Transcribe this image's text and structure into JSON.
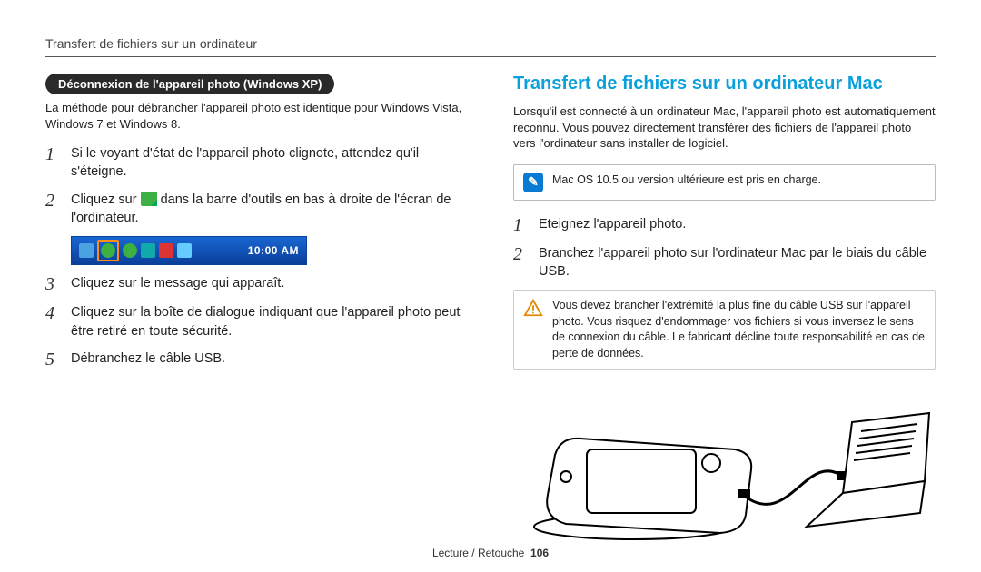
{
  "running_head": "Transfert de fichiers sur un ordinateur",
  "left": {
    "pill": "Déconnexion de l'appareil photo (Windows XP)",
    "intro": "La méthode pour débrancher l'appareil photo est identique pour Windows Vista, Windows 7 et Windows 8.",
    "steps": {
      "s1": "Si le voyant d'état de l'appareil photo clignote, attendez qu'il s'éteigne.",
      "s2_a": "Cliquez sur ",
      "s2_b": " dans la barre d'outils en bas à droite de l'écran de l'ordinateur.",
      "s3": "Cliquez sur le message qui apparaît.",
      "s4": "Cliquez sur la boîte de dialogue indiquant que l'appareil photo peut être retiré en toute sécurité.",
      "s5": "Débranchez le câble USB."
    },
    "tray_time": "10:00 AM"
  },
  "right": {
    "heading": "Transfert de fichiers sur un ordinateur Mac",
    "intro": "Lorsqu'il est connecté à un ordinateur Mac, l'appareil photo est automatiquement reconnu. Vous pouvez directement transférer des fichiers de l'appareil photo vers l'ordinateur sans installer de logiciel.",
    "note": "Mac OS 10.5 ou version ultérieure est pris en charge.",
    "steps": {
      "s1": "Eteignez l'appareil photo.",
      "s2": "Branchez l'appareil photo sur l'ordinateur Mac par le biais du câble USB."
    },
    "warn": "Vous devez brancher l'extrémité la plus fine du câble USB sur l'appareil photo. Vous risquez d'endommager vos fichiers si vous inversez le sens de connexion du câble. Le fabricant décline toute responsabilité en cas de perte de données."
  },
  "footer": {
    "section": "Lecture / Retouche",
    "page": "106"
  },
  "nums": {
    "n1": "1",
    "n2": "2",
    "n3": "3",
    "n4": "4",
    "n5": "5"
  }
}
